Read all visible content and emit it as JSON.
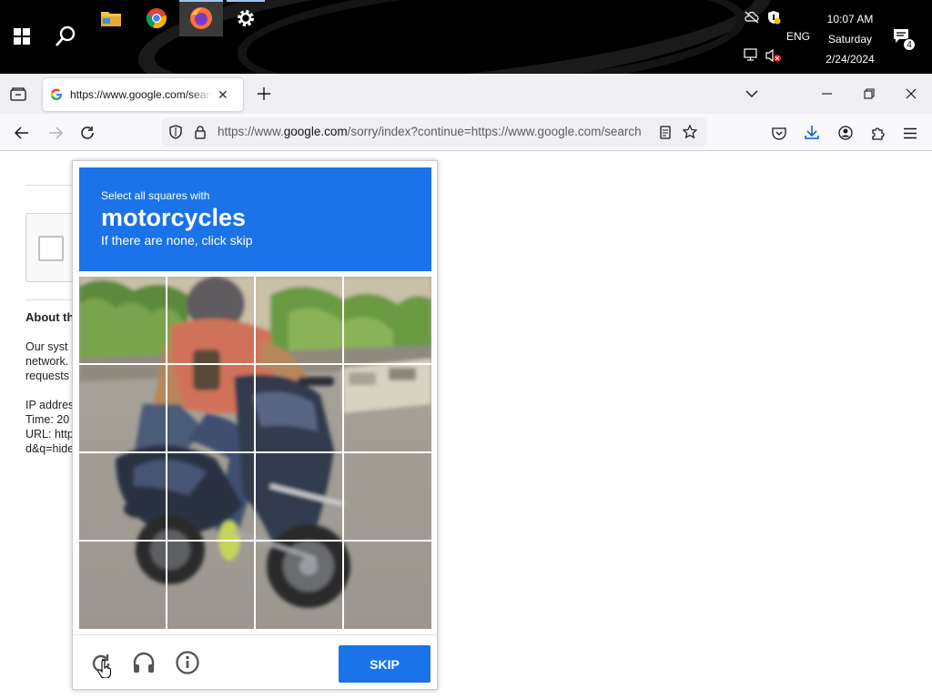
{
  "taskbar": {
    "start_icon": "windows-start-icon",
    "search_icon": "search-icon",
    "apps": [
      {
        "name": "File Explorer",
        "icon": "folder-icon"
      },
      {
        "name": "Google Chrome",
        "icon": "chrome-icon"
      },
      {
        "name": "Firefox",
        "icon": "firefox-icon"
      },
      {
        "name": "Settings",
        "icon": "gear-icon"
      }
    ],
    "tray": {
      "language": "ENG",
      "time": "10:07 AM",
      "day": "Saturday",
      "date": "2/24/2024",
      "notification_count": "4"
    }
  },
  "browser": {
    "tab": {
      "title": "https://www.google.com/search",
      "favicon": "google-g-icon"
    },
    "url": {
      "prefix": "https://www.",
      "domain": "google.com",
      "rest": "/sorry/index?continue=https://www.google.com/search"
    }
  },
  "page": {
    "about_heading": "About th",
    "lines": [
      "Our syst",
      "network.",
      "requests"
    ],
    "ip_line": "IP addres",
    "time_line": "Time: 20",
    "url_line": "URL: http",
    "url_line2": "d&q=hide"
  },
  "captcha": {
    "instruction": "Select all squares with",
    "target": "motorcycles",
    "hint": "If there are none, click skip",
    "skip_label": "SKIP",
    "footer_icons": [
      "reload-icon",
      "headphones-icon",
      "info-icon"
    ],
    "accent_color": "#1a73e8"
  }
}
